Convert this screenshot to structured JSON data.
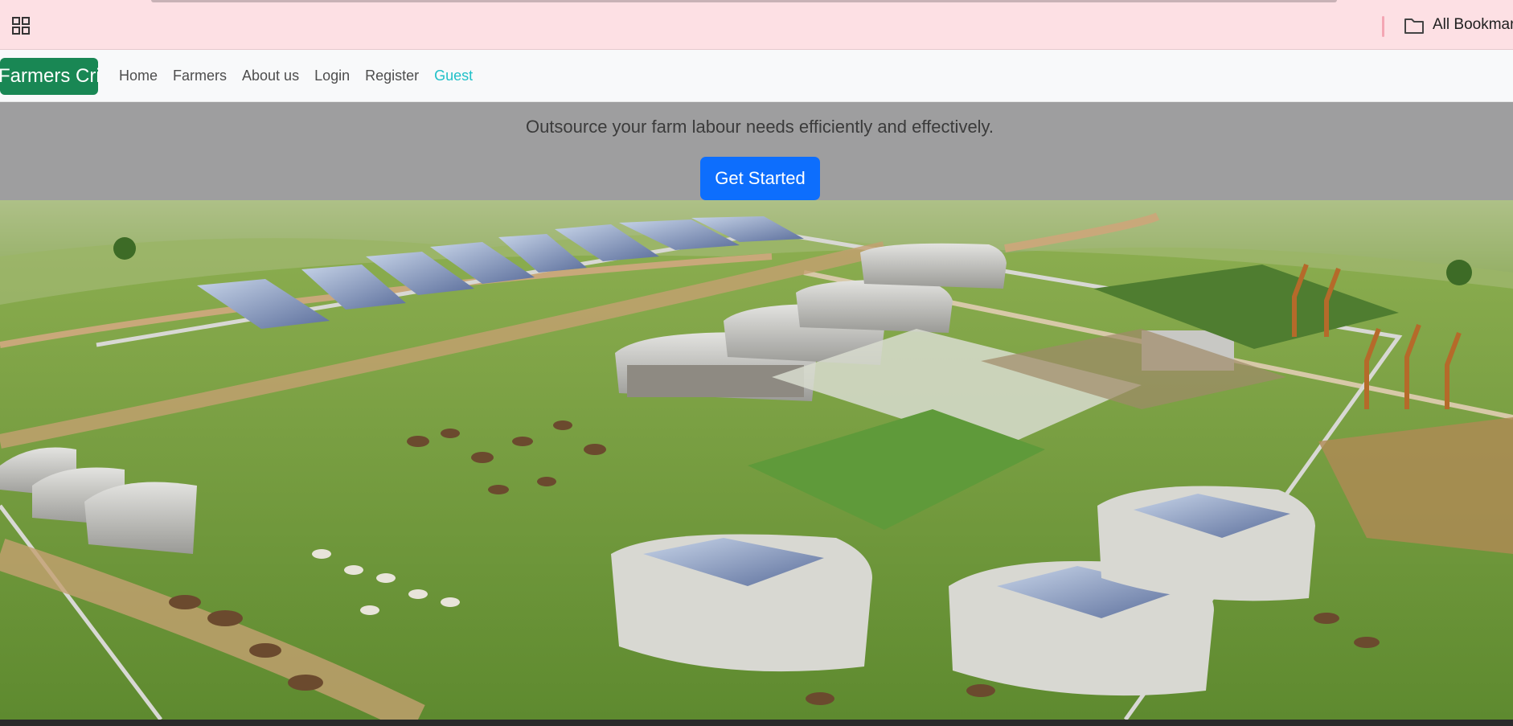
{
  "browser": {
    "bookmarks_label": "All Bookmarks",
    "apps_icon": "apps-grid-icon",
    "folder_icon": "folder-icon"
  },
  "navbar": {
    "brand": "Farmers Crib",
    "brand_color": "#198754",
    "links": [
      {
        "label": "Home"
      },
      {
        "label": "Farmers"
      },
      {
        "label": "About us"
      },
      {
        "label": "Login"
      },
      {
        "label": "Register"
      },
      {
        "label": "Guest",
        "active": true
      }
    ],
    "active_color": "#20c0c8"
  },
  "hero": {
    "tagline": "Outsource your farm labour needs efficiently and effectively.",
    "cta_label": "Get Started",
    "cta_color": "#0d6efd"
  },
  "scene": {
    "description_icon": "farm-illustration"
  }
}
